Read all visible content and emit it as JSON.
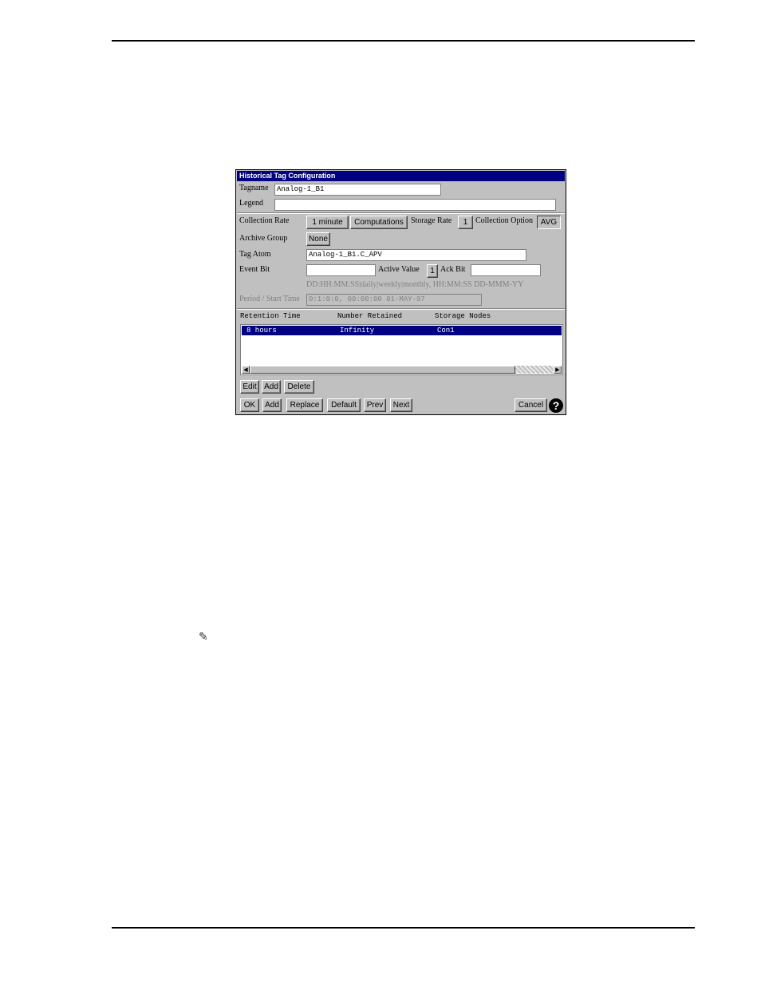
{
  "dialog": {
    "title": "Historical Tag Configuration",
    "tagname": {
      "label": "Tagname",
      "value": "Analog-1_B1"
    },
    "legend": {
      "label": "Legend",
      "value": ""
    },
    "collection_rate": {
      "label": "Collection Rate",
      "value": "1 minute"
    },
    "computations_label": "Computations",
    "storage_rate": {
      "label": "Storage Rate",
      "value": "1"
    },
    "collection_option": {
      "label": "Collection Option",
      "value": "AVG"
    },
    "archive_group": {
      "label": "Archive Group",
      "value": "None"
    },
    "tag_atom": {
      "label": "Tag Atom",
      "value": "Analog-1_B1.C_APV"
    },
    "event_bit": {
      "label": "Event Bit",
      "value": ""
    },
    "active_value": {
      "label": "Active Value",
      "value": "1"
    },
    "ack_bit": {
      "label": "Ack Bit",
      "value": ""
    },
    "format_hint": "DD:HH:MM:SS|daily|weekly|monthly,  HH:MM:SS  DD-MMM-YY",
    "period_start": {
      "label": "Period / Start Time",
      "value": "0:1:0:0,  00:00:00  01-MAY-97"
    },
    "retention_table": {
      "columns": [
        "Retention Time",
        "Number Retained",
        "Storage Nodes"
      ],
      "rows": [
        {
          "retention_time": "8 hours",
          "number_retained": "Infinity",
          "storage_nodes": "Con1"
        }
      ]
    },
    "list_buttons": {
      "edit": "Edit",
      "add": "Add",
      "delete": "Delete"
    },
    "footer_buttons": {
      "ok": "OK",
      "add": "Add",
      "replace": "Replace",
      "default": "Default",
      "prev": "Prev",
      "next": "Next",
      "cancel": "Cancel",
      "help": "?"
    }
  },
  "page": {
    "note_icon": "pencil-icon"
  }
}
